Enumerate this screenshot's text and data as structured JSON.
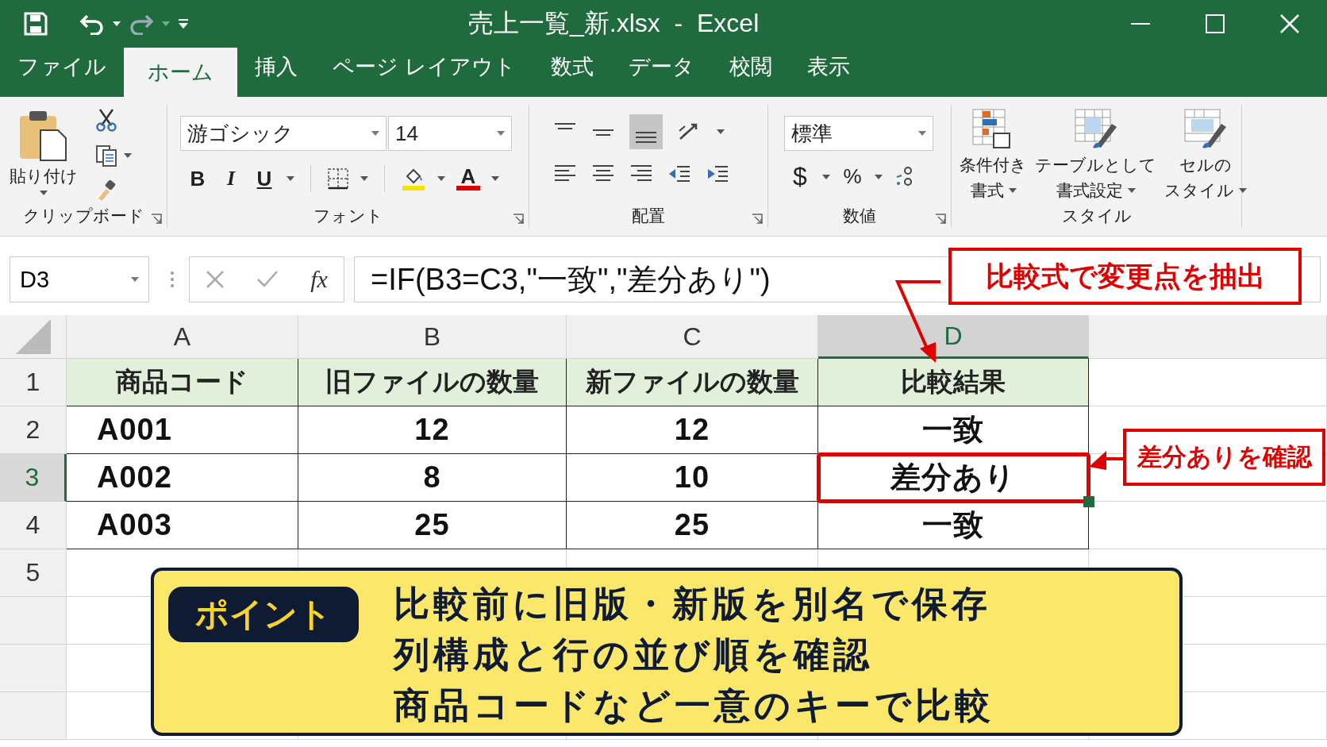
{
  "window": {
    "title": "売上一覧_新.xlsx  -  Excel"
  },
  "tabs": [
    {
      "label": "ファイル",
      "selected": false
    },
    {
      "label": "ホーム",
      "selected": true
    },
    {
      "label": "挿入",
      "selected": false
    },
    {
      "label": "ページ レイアウト",
      "selected": false
    },
    {
      "label": "数式",
      "selected": false
    },
    {
      "label": "データ",
      "selected": false
    },
    {
      "label": "校閲",
      "selected": false
    },
    {
      "label": "表示",
      "selected": false
    }
  ],
  "ribbon": {
    "clipboard": {
      "paste": "貼り付け",
      "label": "クリップボード"
    },
    "font": {
      "name": "游ゴシック",
      "size": "14",
      "bold": "B",
      "italic": "I",
      "underline": "U",
      "font_color": "A",
      "label": "フォント"
    },
    "alignment": {
      "label": "配置"
    },
    "number": {
      "format": "標準",
      "currency": "$",
      "percent": "%",
      "label": "数値"
    },
    "styles": {
      "buttons": [
        {
          "lines": [
            "条件付き",
            "書式"
          ]
        },
        {
          "lines": [
            "テーブルとして",
            "書式設定"
          ]
        },
        {
          "lines": [
            "セルの",
            "スタイル"
          ]
        }
      ],
      "label": "スタイル"
    }
  },
  "formula_bar": {
    "name_box": "D3",
    "fx": "fx",
    "formula": "=IF(B3=C3,\"一致\",\"差分あり\")"
  },
  "sheet": {
    "columns": [
      {
        "label": "A",
        "selected": false
      },
      {
        "label": "B",
        "selected": false
      },
      {
        "label": "C",
        "selected": false
      },
      {
        "label": "D",
        "selected": true
      }
    ],
    "rows": [
      {
        "number": "1",
        "kind": "header",
        "selected": false,
        "cells": [
          {
            "text": "商品コード",
            "selected": false
          },
          {
            "text": "旧ファイルの数量",
            "selected": false
          },
          {
            "text": "新ファイルの数量",
            "selected": false
          },
          {
            "text": "比較結果",
            "selected": false
          }
        ]
      },
      {
        "number": "2",
        "kind": "data",
        "selected": false,
        "cells": [
          {
            "text": "A001",
            "selected": false
          },
          {
            "text": "12",
            "selected": false
          },
          {
            "text": "12",
            "selected": false
          },
          {
            "text": "一致",
            "selected": false
          }
        ]
      },
      {
        "number": "3",
        "kind": "data",
        "selected": true,
        "cells": [
          {
            "text": "A002",
            "selected": false
          },
          {
            "text": "8",
            "selected": false
          },
          {
            "text": "10",
            "selected": false
          },
          {
            "text": "差分あり",
            "selected": true
          }
        ]
      },
      {
        "number": "4",
        "kind": "data",
        "selected": false,
        "cells": [
          {
            "text": "A003",
            "selected": false
          },
          {
            "text": "25",
            "selected": false
          },
          {
            "text": "25",
            "selected": false
          },
          {
            "text": "一致",
            "selected": false
          }
        ]
      },
      {
        "number": "5",
        "kind": "empty",
        "selected": false,
        "cells": []
      }
    ]
  },
  "callouts": [
    {
      "text": "比較式で変更点を抽出",
      "kind": "column"
    },
    {
      "text": "差分ありを確認",
      "kind": "cell"
    }
  ],
  "point": {
    "badge": "ポイント",
    "lines": [
      "比較前に旧版・新版を別名で保存",
      "列構成と行の並び順を確認",
      "商品コードなど一意のキーで比較"
    ]
  }
}
